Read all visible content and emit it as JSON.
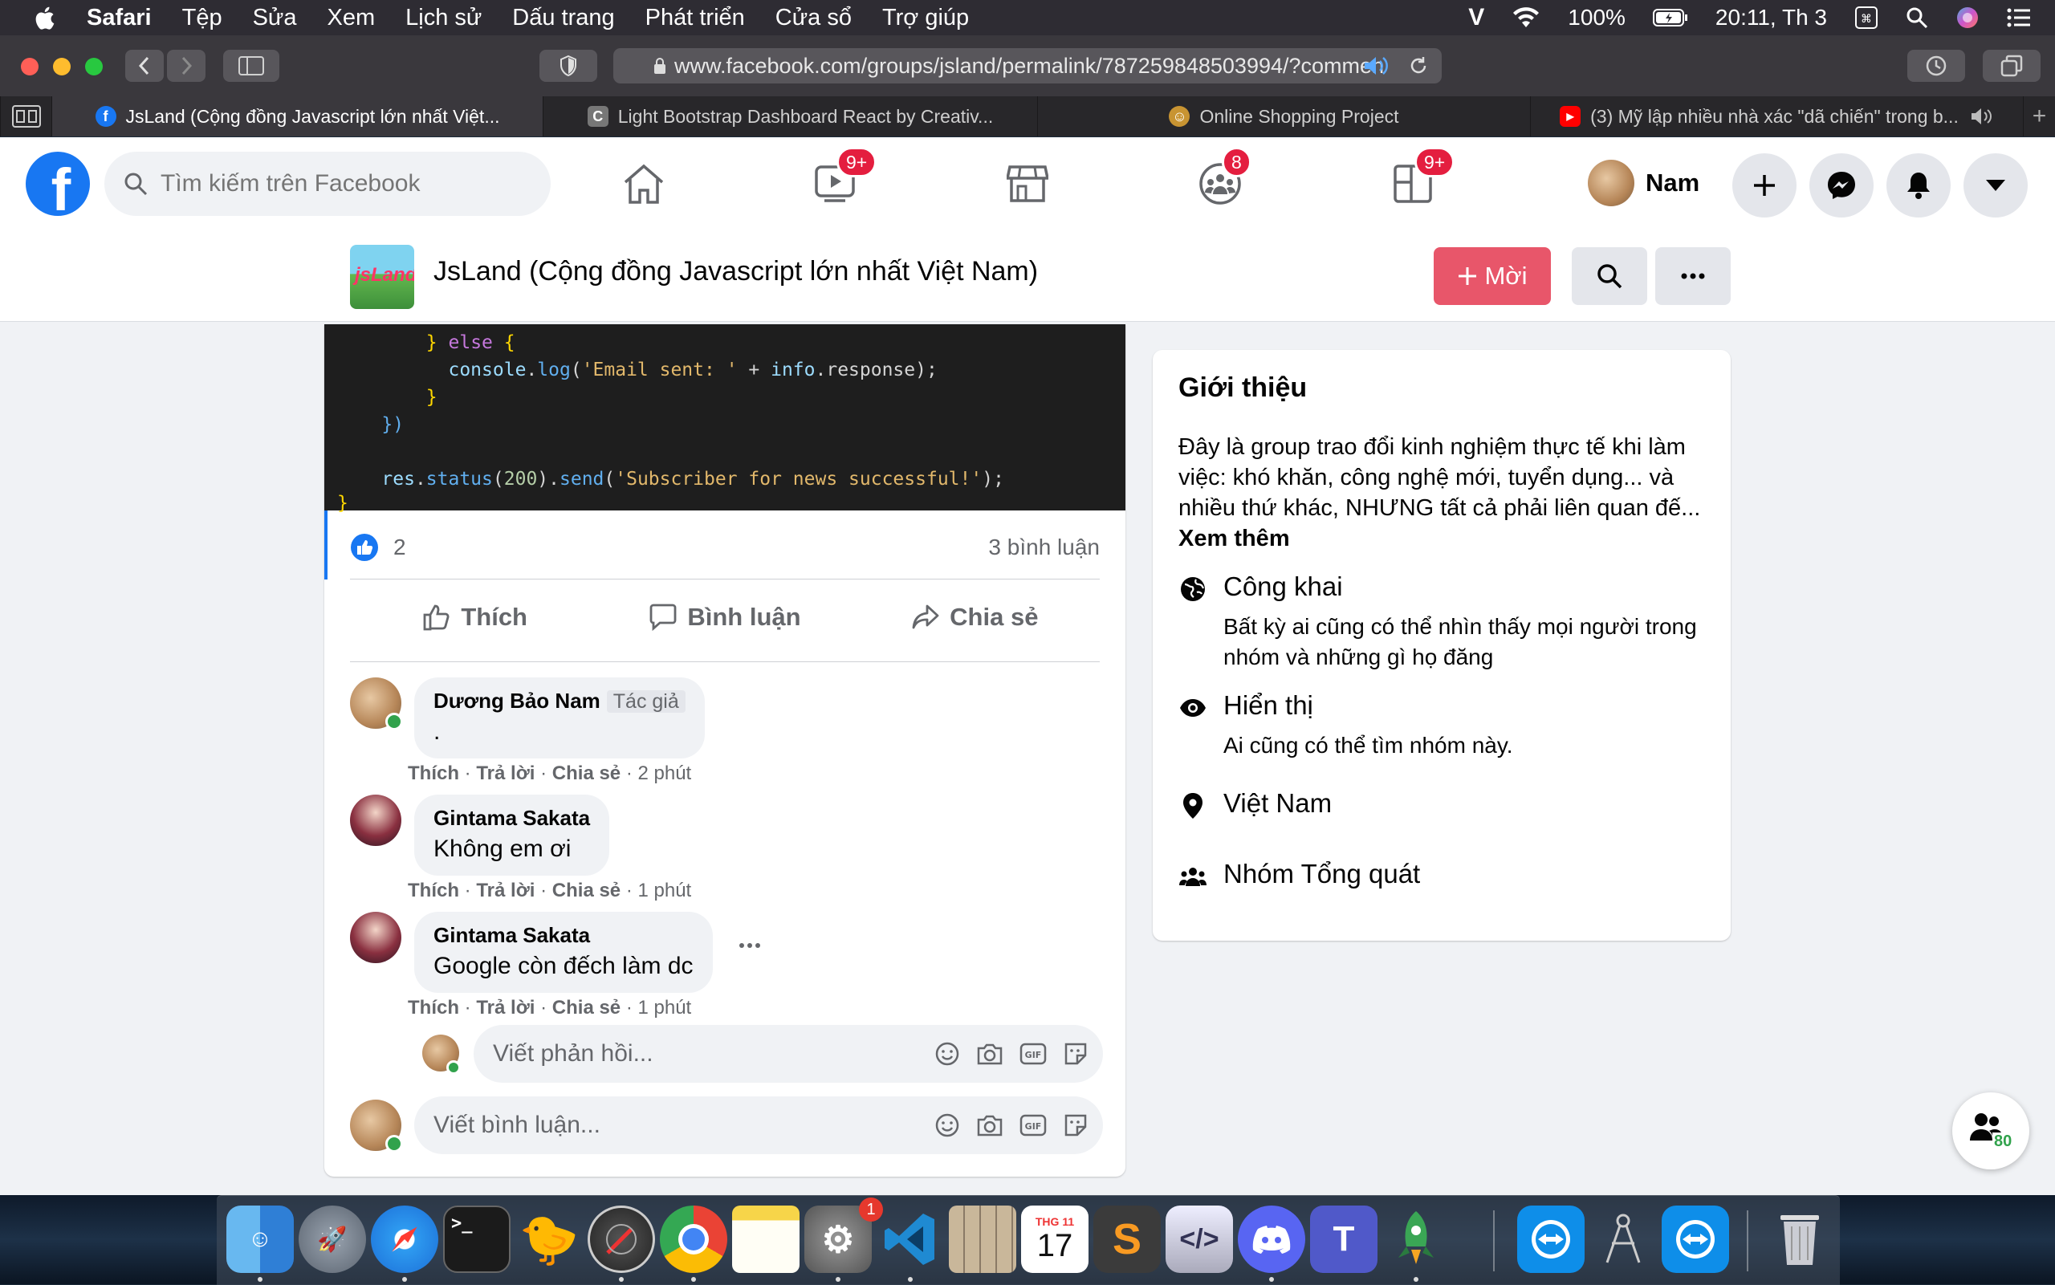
{
  "menubar": {
    "app": "Safari",
    "items": [
      "Tệp",
      "Sửa",
      "Xem",
      "Lịch sử",
      "Dấu trang",
      "Phát triển",
      "Cửa sổ",
      "Trợ giúp"
    ],
    "battery": "100%",
    "clock": "20:11, Th 3"
  },
  "browser": {
    "url": "www.facebook.com/groups/jsland/permalink/787259848503994/?commen",
    "tabs": [
      {
        "title": "JsLand (Cộng đồng Javascript lớn nhất Việt...",
        "active": true
      },
      {
        "title": "Light Bootstrap Dashboard React by Creativ...",
        "active": false
      },
      {
        "title": "Online Shopping Project",
        "active": false
      },
      {
        "title": "(3) Mỹ lập nhiều nhà xác \"dã chiến\" trong b...",
        "active": false
      }
    ]
  },
  "fb": {
    "search_placeholder": "Tìm kiếm trên Facebook",
    "badges": {
      "watch": "9+",
      "groups": "8",
      "gaming": "9+"
    },
    "user": "Nam"
  },
  "group": {
    "title": "JsLand (Cộng đồng Javascript lớn nhất Việt Nam)",
    "thumb_text": "jsLand",
    "invite_label": "Mời"
  },
  "post": {
    "like_count": "2",
    "comment_count": "3 bình luận",
    "actions": {
      "like": "Thích",
      "comment": "Bình luận",
      "share": "Chia sẻ"
    },
    "comments": [
      {
        "author": "Dương Bảo Nam",
        "tag": "Tác giả",
        "text": ".",
        "time": "2 phút"
      },
      {
        "author": "Gintama Sakata",
        "tag": "",
        "text": "Không em ơi",
        "time": "1 phút"
      },
      {
        "author": "Gintama Sakata",
        "tag": "",
        "text": "Google còn đếch làm dc",
        "time": "1 phút"
      }
    ],
    "meta_actions": {
      "like": "Thích",
      "reply": "Trả lời",
      "share": "Chia sẻ",
      "sep": "·"
    },
    "reply_placeholder": "Viết phản hồi...",
    "comment_placeholder": "Viết bình luận..."
  },
  "about": {
    "heading": "Giới thiệu",
    "description": "Đây là group trao đổi kinh nghiệm thực tế khi làm việc: khó khăn, công nghệ mới, tuyển dụng... và nhiều thứ khác, NHƯNG tất cả phải liên quan đế...",
    "see_more": "Xem thêm",
    "rows": [
      {
        "title": "Công khai",
        "sub": "Bất kỳ ai cũng có thể nhìn thấy mọi người trong nhóm và những gì họ đăng"
      },
      {
        "title": "Hiển thị",
        "sub": "Ai cũng có thể tìm nhóm này."
      },
      {
        "title": "Việt Nam",
        "sub": ""
      },
      {
        "title": "Nhóm Tổng quát",
        "sub": ""
      }
    ]
  },
  "friends_online": "80",
  "dock": {
    "calendar_month": "THG 11",
    "calendar_day": "17",
    "sysprefs_badge": "1"
  }
}
